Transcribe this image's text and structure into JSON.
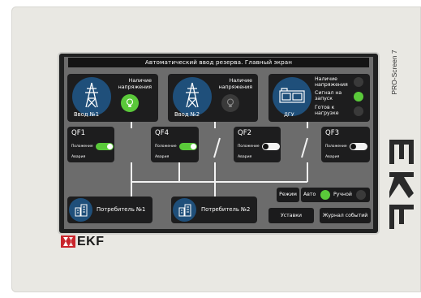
{
  "colors": {
    "accent_green": "#5ac93a",
    "panel": "#1d1d1e",
    "screen_bg": "#6c6c6c",
    "icon_circle": "#1f4f7a",
    "inactive_circle": "#3a3a3a"
  },
  "screen": {
    "title": "Автоматический ввод резерва. Главный экран"
  },
  "inputs": [
    {
      "name": "Ввод №1",
      "status_label": "Наличие напряжения",
      "lamp_on": true
    },
    {
      "name": "Ввод №2",
      "status_label": "Наличие напряжения",
      "lamp_on": false
    }
  ],
  "dgu": {
    "name": "ДГУ",
    "rows": [
      "Наличие напряжения",
      "Сигнал на запуск",
      "Готов к нагрузке"
    ],
    "lamps_on": [
      false,
      true,
      false
    ]
  },
  "breakers": [
    {
      "name": "QF1",
      "position_label": "Положение",
      "alarm_label": "Авария",
      "on": true
    },
    {
      "name": "QF4",
      "position_label": "Положение",
      "alarm_label": "Авария",
      "on": true
    },
    {
      "name": "QF2",
      "position_label": "Положение",
      "alarm_label": "Авария",
      "on": false
    },
    {
      "name": "QF3",
      "position_label": "Положение",
      "alarm_label": "Авария",
      "on": false
    }
  ],
  "consumers": [
    {
      "name": "Потребитель №1"
    },
    {
      "name": "Потребитель №2"
    }
  ],
  "mode": {
    "label": "Режим",
    "auto": "Авто",
    "manual": "Ручной",
    "auto_active": true
  },
  "buttons": {
    "settings": "Уставки",
    "event_log": "Журнал событий"
  },
  "device": {
    "model": "PRO-Screen 7",
    "brand": "EKF"
  },
  "icons": [
    "power-tower-icon",
    "lightbulb-icon",
    "generator-icon",
    "building-icon",
    "ekf-logo-icon"
  ]
}
